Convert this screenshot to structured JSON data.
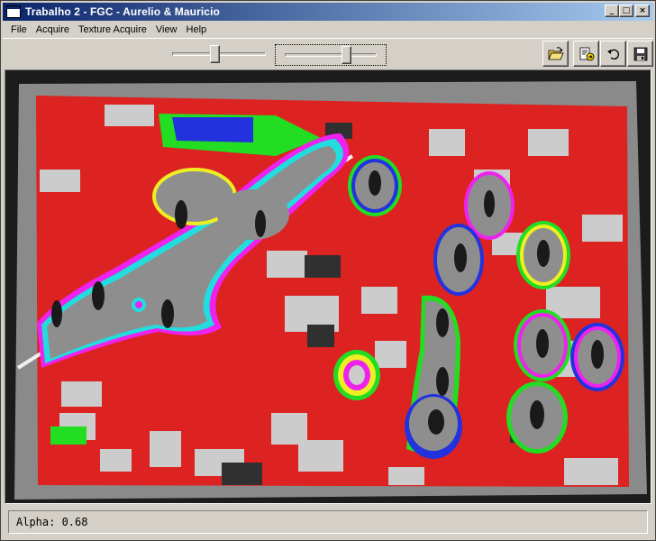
{
  "window": {
    "title": "Trabalho 2 - FGC - Aurelio & Mauricio",
    "minimize_glyph": "_",
    "maximize_glyph": "□",
    "close_glyph": "×"
  },
  "menu": {
    "items": [
      {
        "label": "File"
      },
      {
        "label": "Acquire"
      },
      {
        "label": "Texture Acquire"
      },
      {
        "label": "View"
      },
      {
        "label": "Help"
      }
    ]
  },
  "toolbar": {
    "slider1_value": 0.45,
    "slider2_value": 0.66,
    "buttons": [
      {
        "icon": "open-folder-icon"
      },
      {
        "icon": "export-icon"
      },
      {
        "icon": "undo-icon"
      },
      {
        "icon": "save-disk-icon"
      }
    ]
  },
  "viewer": {
    "content": "segmented soccer video frame",
    "colors": {
      "field_red": "#dd2222",
      "field_gray": "#cccccc",
      "blob_blue": "#2233dd",
      "blob_green": "#22dd22",
      "blob_magenta": "#ee22ee",
      "blob_yellow": "#eeee22",
      "blob_cyan": "#22dddd"
    }
  },
  "status": {
    "text": "Alpha: 0.68"
  }
}
